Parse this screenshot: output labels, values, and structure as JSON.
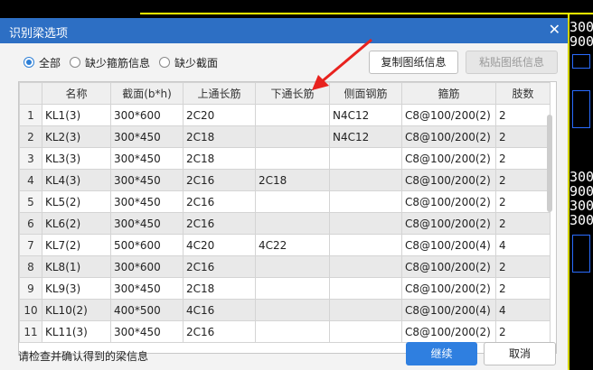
{
  "window": {
    "title": "识别梁选项"
  },
  "icons": {
    "close": "close-icon"
  },
  "filters": [
    {
      "label": "全部",
      "selected": true
    },
    {
      "label": "缺少箍筋信息",
      "selected": false
    },
    {
      "label": "缺少截面",
      "selected": false
    }
  ],
  "buttons": {
    "copy": "复制图纸信息",
    "paste": "粘贴图纸信息",
    "continue": "继续",
    "cancel": "取消"
  },
  "table": {
    "columns": [
      "",
      "名称",
      "截面(b*h)",
      "上通长筋",
      "下通长筋",
      "侧面钢筋",
      "箍筋",
      "肢数"
    ],
    "rows": [
      [
        "1",
        "KL1(3)",
        "300*600",
        "2C20",
        "",
        "N4C12",
        "C8@100/200(2)",
        "2"
      ],
      [
        "2",
        "KL2(3)",
        "300*450",
        "2C18",
        "",
        "N4C12",
        "C8@100/200(2)",
        "2"
      ],
      [
        "3",
        "KL3(3)",
        "300*450",
        "2C18",
        "",
        "",
        "C8@100/200(2)",
        "2"
      ],
      [
        "4",
        "KL4(3)",
        "300*450",
        "2C16",
        "2C18",
        "",
        "C8@100/200(2)",
        "2"
      ],
      [
        "5",
        "KL5(2)",
        "300*450",
        "2C16",
        "",
        "",
        "C8@100/200(2)",
        "2"
      ],
      [
        "6",
        "KL6(2)",
        "300*450",
        "2C16",
        "",
        "",
        "C8@100/200(2)",
        "2"
      ],
      [
        "7",
        "KL7(2)",
        "500*600",
        "4C20",
        "4C22",
        "",
        "C8@100/200(4)",
        "4"
      ],
      [
        "8",
        "KL8(1)",
        "300*600",
        "2C16",
        "",
        "",
        "C8@100/200(2)",
        "2"
      ],
      [
        "9",
        "KL9(3)",
        "300*450",
        "2C18",
        "",
        "",
        "C8@100/200(2)",
        "2"
      ],
      [
        "10",
        "KL10(2)",
        "400*500",
        "4C16",
        "",
        "",
        "C8@100/200(4)",
        "4"
      ],
      [
        "11",
        "KL11(3)",
        "300*450",
        "2C16",
        "",
        "",
        "C8@100/200(2)",
        "2"
      ]
    ]
  },
  "status_text": "请检查并确认得到的梁信息",
  "cad_text": [
    "300",
    "900",
    "300",
    "900",
    "300",
    "300"
  ],
  "colors": {
    "titlebar": "#2d6fc4",
    "annotation_arrow": "#e8221e",
    "cad_lines": "#ffff00"
  }
}
